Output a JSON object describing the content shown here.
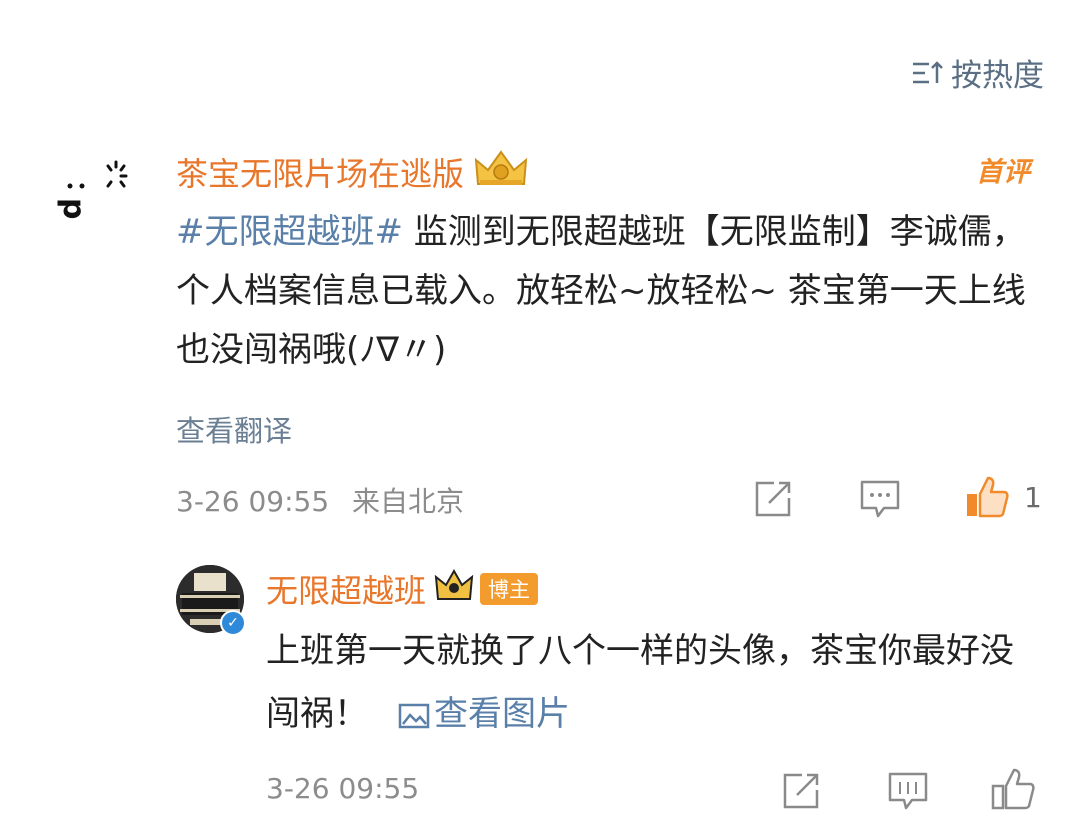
{
  "sort": {
    "label": "按热度",
    "icon": "sort-icon"
  },
  "comment": {
    "username": "茶宝无限片场在逃版",
    "badge": "首评",
    "topic": "#无限超越班#",
    "text": " 监测到无限超越班【无限监制】李诚儒，个人档案信息已载入。放轻松~放轻松~ 茶宝第一天上线也没闯祸哦(ﾉ∇〃)",
    "translate": "查看翻译",
    "time": "3-26 09:55",
    "location": "来自北京",
    "likes": "1",
    "avatar_text": "p..."
  },
  "reply": {
    "username": "无限超越班",
    "badge": "博主",
    "text": "上班第一天就换了八个一样的头像，茶宝你最好没闯祸！",
    "view_pic": "查看图片",
    "time": "3-26 09:55"
  },
  "colors": {
    "username": "#e8762b",
    "link": "#5a7fa8",
    "meta": "#8c8c8c",
    "like_active": "#f08a2a"
  }
}
